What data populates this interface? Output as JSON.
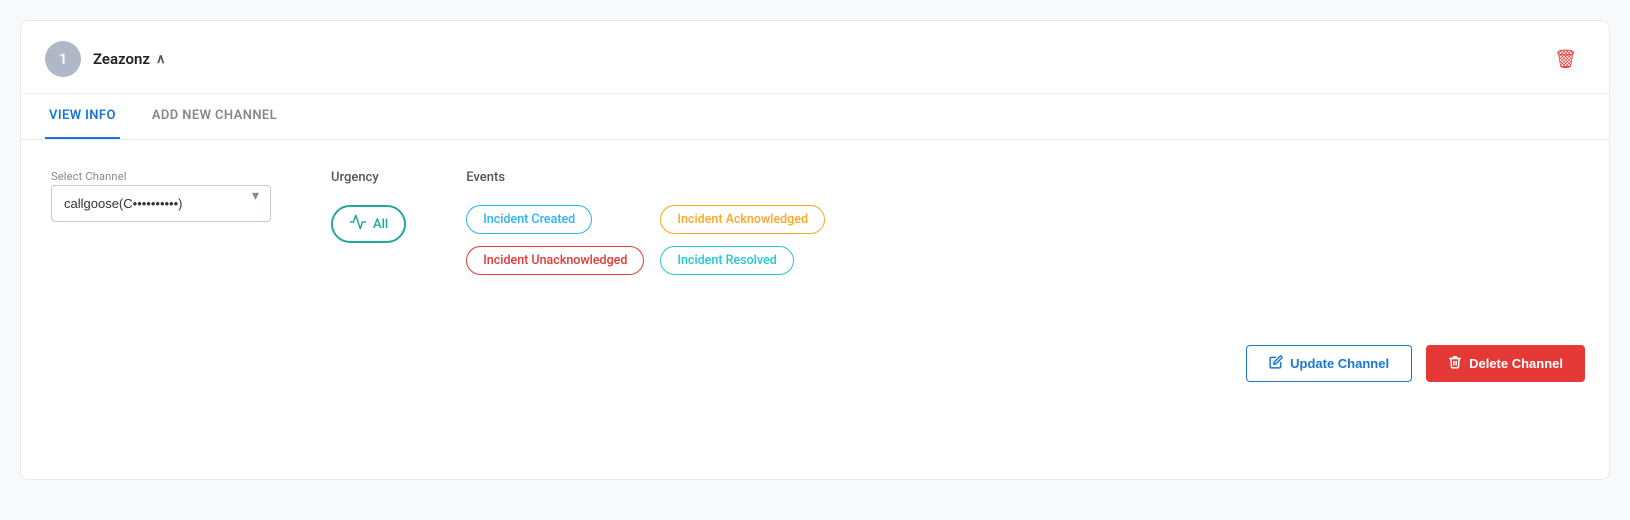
{
  "header": {
    "avatar_text": "1",
    "service_name": "Zeazonz",
    "delete_icon": "🗑"
  },
  "tabs": [
    {
      "id": "view-info",
      "label": "VIEW INFO",
      "active": true
    },
    {
      "id": "add-new-channel",
      "label": "ADD NEW CHANNEL",
      "active": false
    }
  ],
  "select_channel": {
    "label": "Select Channel",
    "value": "callgoose(C",
    "placeholder": "callgoose(C...)"
  },
  "urgency": {
    "label": "Urgency",
    "badge_label": "All",
    "icon": "⍡"
  },
  "events": {
    "label": "Events",
    "items": [
      {
        "id": "incident-created",
        "label": "Incident Created",
        "style": "blue"
      },
      {
        "id": "incident-acknowledged",
        "label": "Incident Acknowledged",
        "style": "orange"
      },
      {
        "id": "incident-unacknowledged",
        "label": "Incident Unacknowledged",
        "style": "red"
      },
      {
        "id": "incident-resolved",
        "label": "Incident Resolved",
        "style": "teal"
      }
    ]
  },
  "footer": {
    "update_label": "Update Channel",
    "delete_label": "Delete Channel",
    "update_icon": "✏",
    "delete_icon": "🗑"
  }
}
